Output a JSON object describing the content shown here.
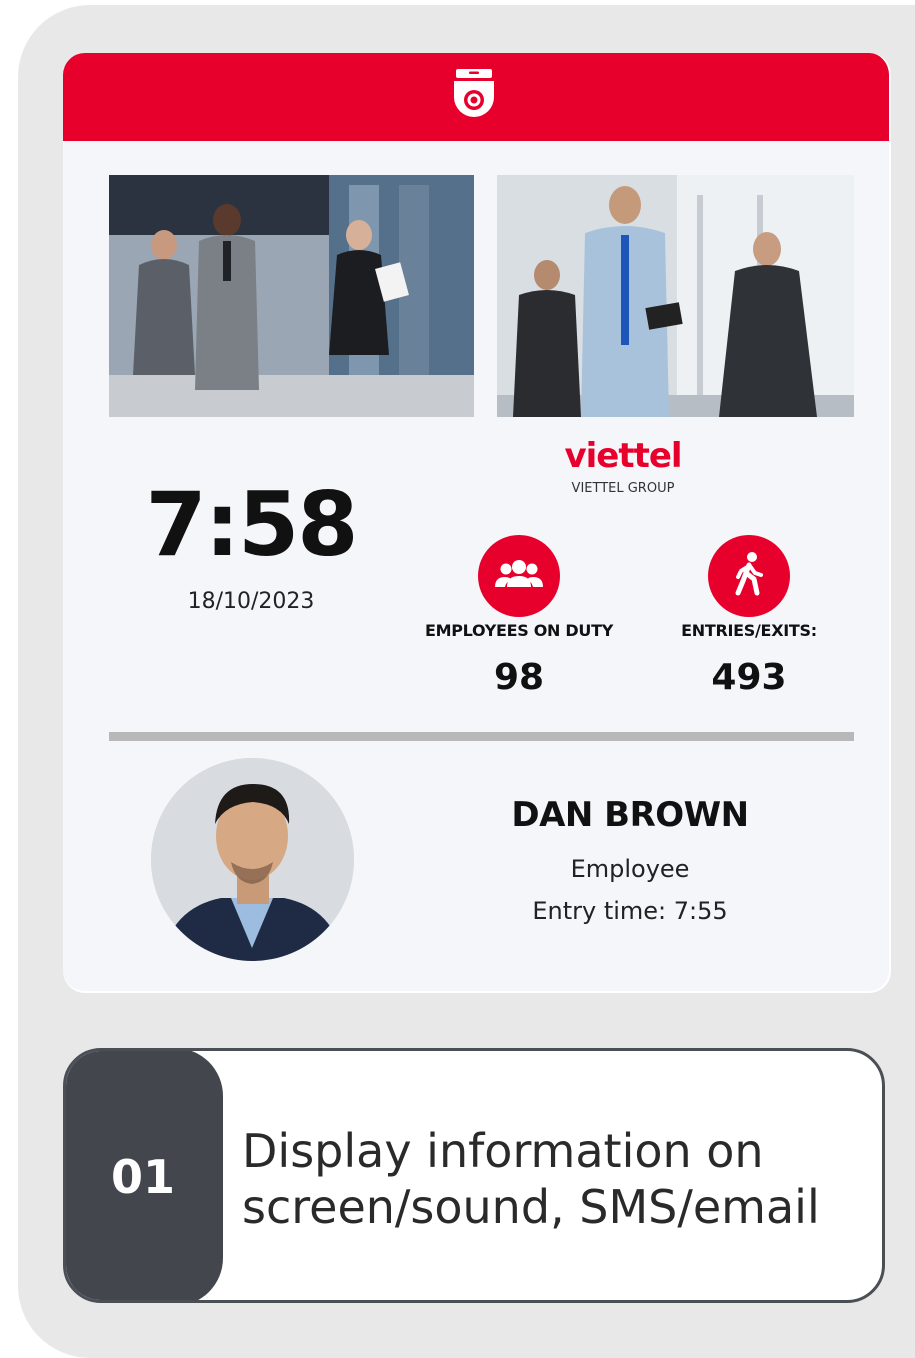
{
  "brand": {
    "logo_text": "viettel",
    "group_label": "VIETTEL GROUP",
    "accent_color": "#e8002d"
  },
  "header": {
    "icon": "security-camera-icon"
  },
  "clock": {
    "time": "7:58",
    "date": "18/10/2023"
  },
  "stats": [
    {
      "icon": "employees-group-icon",
      "label": "EMPLOYEES ON DUTY",
      "value": "98"
    },
    {
      "icon": "walking-person-icon",
      "label": "ENTRIES/EXITS:",
      "value": "493"
    }
  ],
  "person": {
    "name": "DAN BROWN",
    "role": "Employee",
    "entry": "Entry time: 7:55"
  },
  "feature": {
    "number": "01",
    "line1": "Display information on",
    "line2": "screen/sound, SMS/email"
  }
}
